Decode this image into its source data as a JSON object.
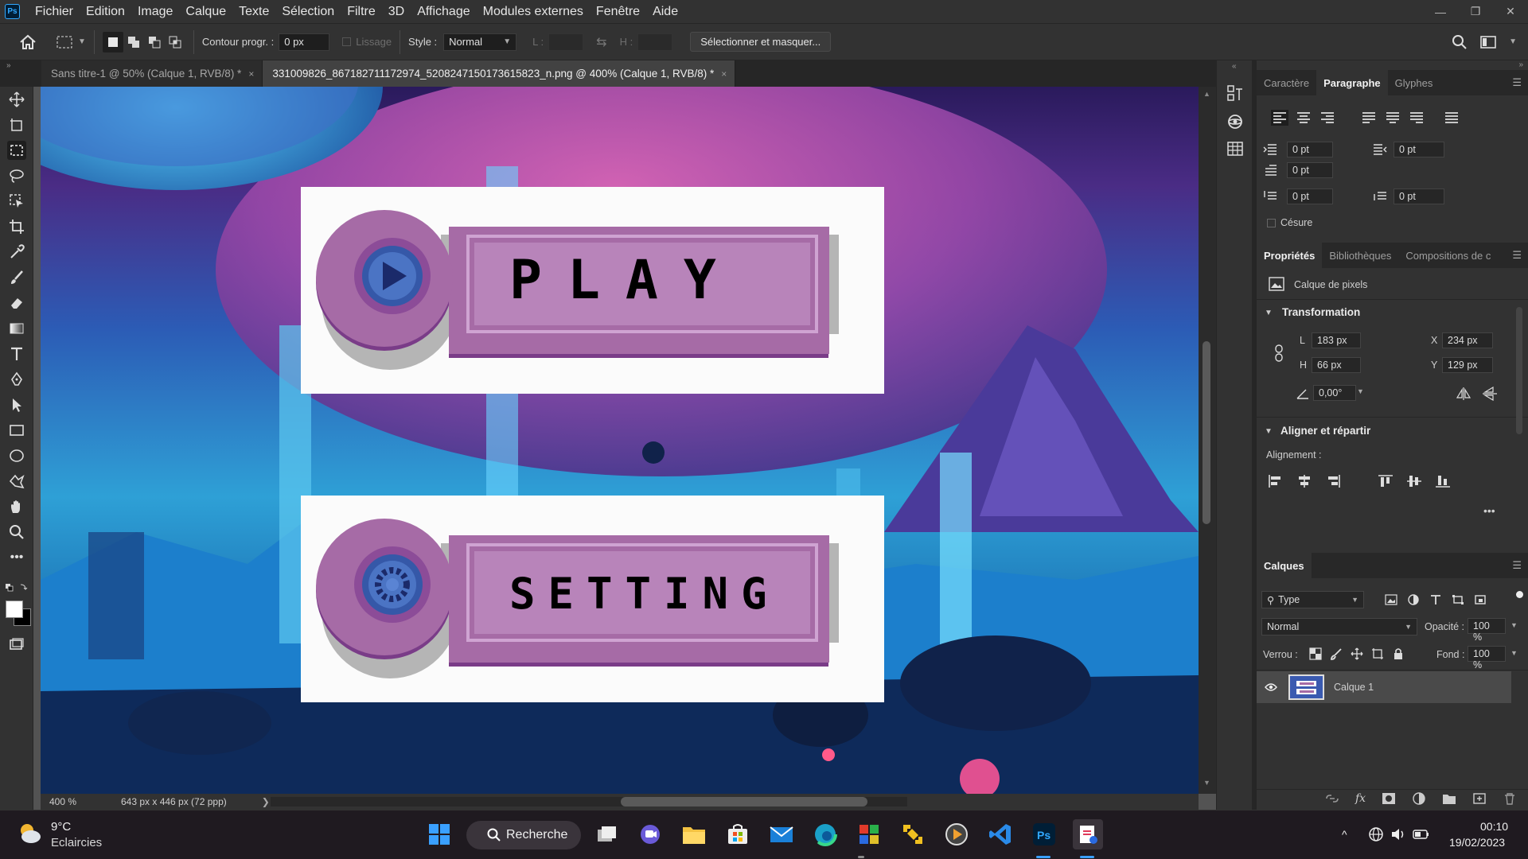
{
  "menubar": {
    "items": [
      "Fichier",
      "Edition",
      "Image",
      "Calque",
      "Texte",
      "Sélection",
      "Filtre",
      "3D",
      "Affichage",
      "Modules externes",
      "Fenêtre",
      "Aide"
    ]
  },
  "options": {
    "contour_label": "Contour progr. :",
    "contour_value": "0 px",
    "lissage_label": "Lissage",
    "style_label": "Style :",
    "style_value": "Normal",
    "l_label": "L :",
    "h_label": "H :",
    "select_mask_label": "Sélectionner et masquer..."
  },
  "tabs": [
    {
      "label": "Sans titre-1 @ 50% (Calque 1, RVB/8) *",
      "close": "×"
    },
    {
      "label": "331009826_867182711172974_5208247150173615823_n.png @ 400% (Calque 1, RVB/8) *",
      "close": "×"
    }
  ],
  "artwork": {
    "play_label": "PLAY",
    "setting_label": "SETTING",
    "colors": {
      "button_purple": "#a66ba6",
      "button_dark": "#7a3c88",
      "frame_inner": "#b884ba",
      "circle_blue": "#3558a8",
      "card_bg": "#fbfbfb"
    }
  },
  "status": {
    "zoom": "400 %",
    "doc_info": "643 px x 446 px (72 ppp)"
  },
  "panels": {
    "top_tabs": [
      "Caractère",
      "Paragraphe",
      "Glyphes"
    ],
    "paragraph_fields": [
      "0 pt",
      "0 pt",
      "0 pt",
      "0 pt",
      "0 pt"
    ],
    "cesure_label": "Césure",
    "prop_tabs": [
      "Propriétés",
      "Bibliothèques",
      "Compositions de c"
    ],
    "pixel_layer_label": "Calque de pixels",
    "transformation_label": "Transformation",
    "l_label": "L",
    "l_value": "183 px",
    "h_label": "H",
    "h_value": "66 px",
    "x_label": "X",
    "x_value": "234 px",
    "y_label": "Y",
    "y_value": "129 px",
    "angle_value": "0,00°",
    "align_title": "Aligner et répartir",
    "alignment_label": "Alignement :",
    "more": "•••",
    "layers_tab": "Calques",
    "filter_value": "Type",
    "blend_value": "Normal",
    "opacity_label": "Opacité :",
    "opacity_value": "100 %",
    "lock_label": "Verrou :",
    "fill_label": "Fond :",
    "fill_value": "100 %",
    "layer_name": "Calque 1"
  },
  "taskbar": {
    "weather_temp": "9°C",
    "weather_desc": "Eclaircies",
    "search_label": "Recherche",
    "time": "00:10",
    "date": "19/02/2023"
  }
}
